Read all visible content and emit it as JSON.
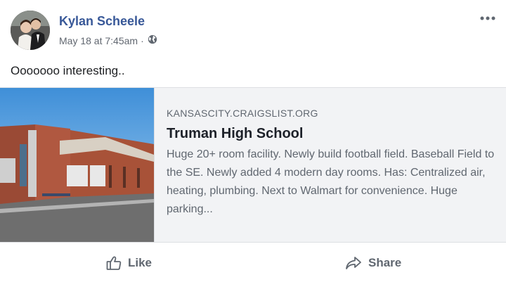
{
  "post": {
    "author": "Kylan Scheele",
    "timestamp": "May 18 at 7:45am",
    "separator": "·",
    "privacy_icon": "globe-icon",
    "more_icon": "ellipsis-icon",
    "text": "Ooooooo interesting.."
  },
  "link_preview": {
    "domain": "KANSASCITY.CRAIGSLIST.ORG",
    "title": "Truman High School",
    "description": "Huge 20+ room facility. Newly build football field. Baseball Field to the SE. Newly added 4 modern day rooms. Has: Centralized air, heating, plumbing. Next to Walmart for convenience. Huge parking..."
  },
  "actions": {
    "like_label": "Like",
    "share_label": "Share",
    "like_icon": "thumbs-up-icon",
    "share_icon": "share-arrow-icon"
  },
  "colors": {
    "author_link": "#385898",
    "secondary_text": "#606770",
    "card_background": "#f2f3f5",
    "border": "#dddfe2"
  }
}
